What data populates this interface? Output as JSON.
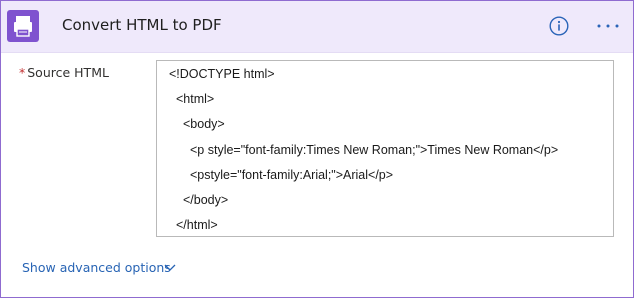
{
  "action": {
    "title": "Convert HTML to PDF",
    "brand_color": "#7f53cf",
    "icon": "printer-icon"
  },
  "header_actions": {
    "info_icon": "info-icon",
    "more_icon": "more-options-icon"
  },
  "field": {
    "required_marker": "*",
    "label": "Source HTML",
    "value_lines": [
      "<!DOCTYPE html>",
      "<html>",
      "<body>",
      "<p style=\"font-family:Times New Roman;\">Times New Roman</p>",
      "<pstyle=\"font-family:Arial;\">Arial</p>",
      "</body>",
      "</html>"
    ]
  },
  "advanced": {
    "label": "Show advanced options",
    "chevron_icon": "chevron-down-icon"
  },
  "colors": {
    "link": "#2864b4",
    "border_accent": "#8f6bd0",
    "header_bg": "#efe9fb"
  }
}
